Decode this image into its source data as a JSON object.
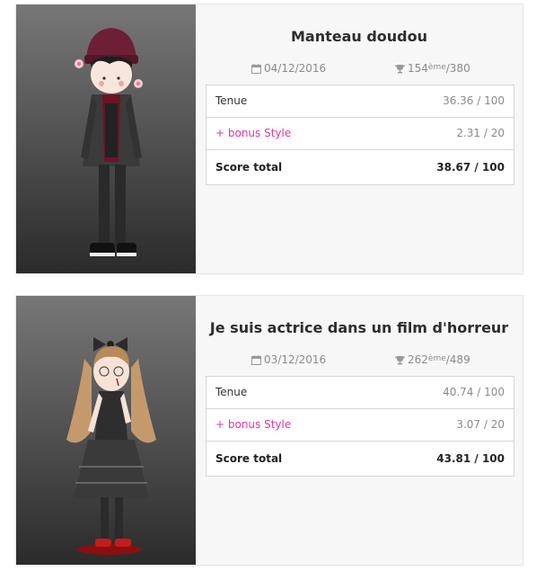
{
  "outfits": [
    {
      "title": "Manteau doudou",
      "date": "04/12/2016",
      "rank": "154",
      "rank_suffix": "ème",
      "rank_total": "/380",
      "rows": [
        {
          "label": "Tenue",
          "value": "36.36 / 100"
        },
        {
          "label": "+ bonus Style",
          "value": "2.31 / 20"
        },
        {
          "label": "Score total",
          "value": "38.67 / 100"
        }
      ]
    },
    {
      "title": "Je suis actrice dans un film d'horreur",
      "date": "03/12/2016",
      "rank": "262",
      "rank_suffix": "ème",
      "rank_total": "/489",
      "rows": [
        {
          "label": "Tenue",
          "value": "40.74 / 100"
        },
        {
          "label": "+ bonus Style",
          "value": "3.07 / 20"
        },
        {
          "label": "Score total",
          "value": "43.81 / 100"
        }
      ]
    }
  ],
  "colors": {
    "bonus": "#e2369e",
    "card_bg": "#f7f7f7",
    "border": "#d6d6d6"
  },
  "icons": {
    "date": "calendar-icon",
    "rank": "trophy-icon"
  }
}
